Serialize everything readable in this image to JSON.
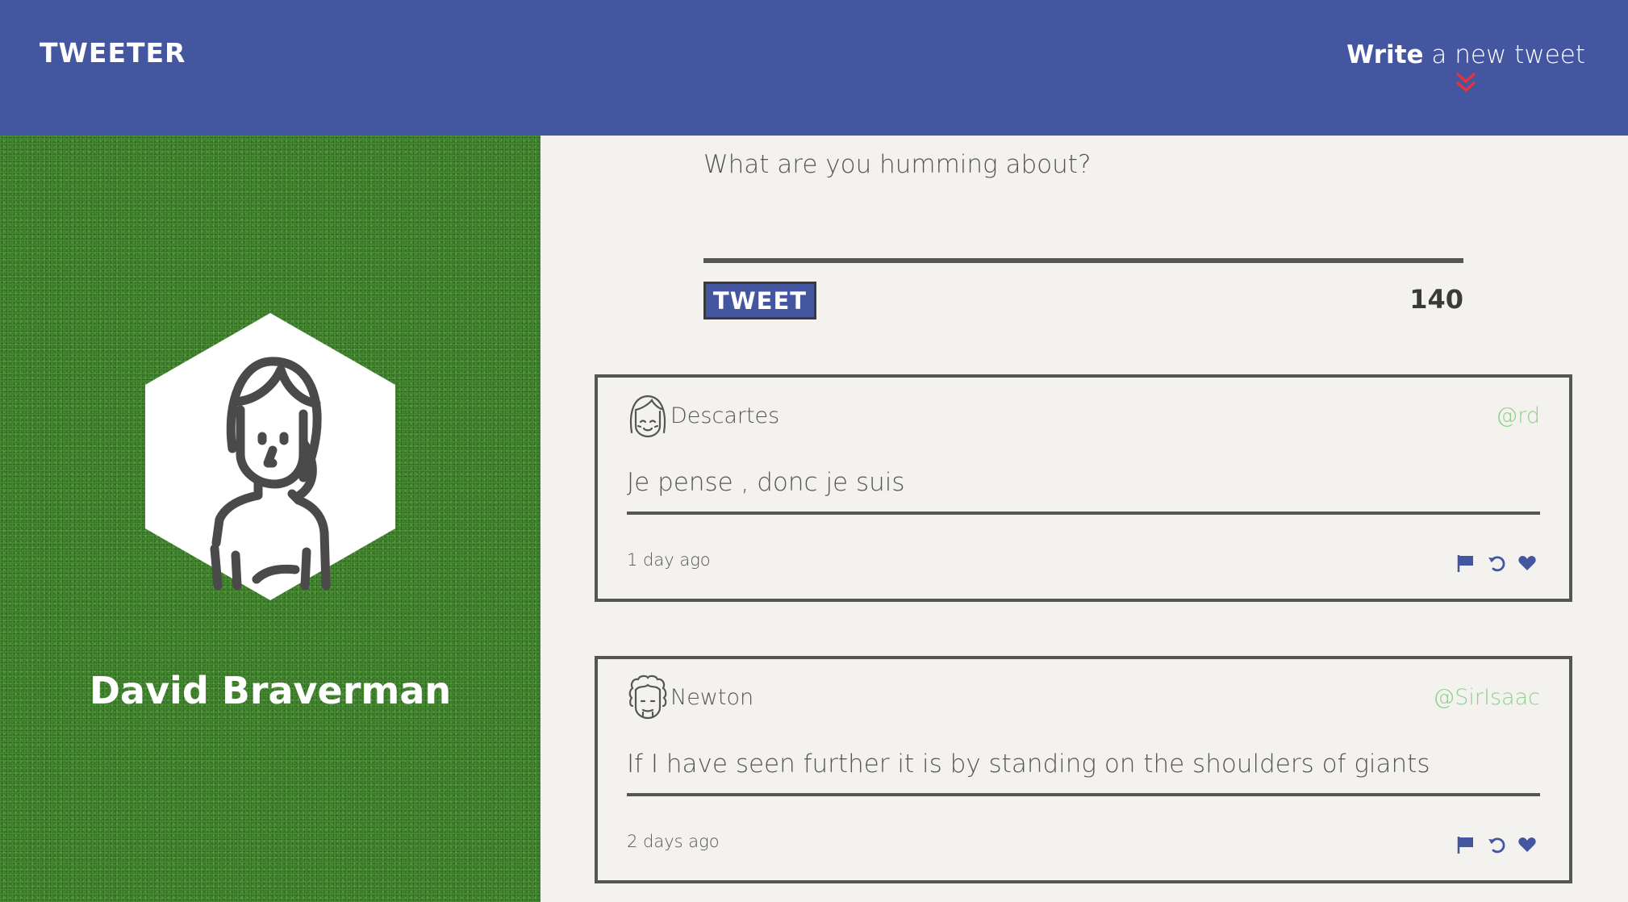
{
  "nav": {
    "brand": "TWEETER",
    "compose_bold": "Write",
    "compose_rest": " a new tweet",
    "accent_color": "#e0353b",
    "background_color": "#4556a0"
  },
  "sidebar": {
    "profile_name": "David Braverman",
    "avatar_icon": "woman-avatar-icon",
    "background_color": "#4b9236"
  },
  "compose": {
    "placeholder": "What are you humming about?",
    "button_label": "TWEET",
    "counter": "140"
  },
  "tweets": [
    {
      "author": "Descartes",
      "handle": "@rd",
      "avatar_icon": "girl-avatar-icon",
      "body": "Je pense , donc je suis",
      "time": "1 day ago",
      "actions": [
        "flag-icon",
        "retweet-icon",
        "heart-icon"
      ]
    },
    {
      "author": "Newton",
      "handle": "@SirIsaac",
      "avatar_icon": "curly-hair-avatar-icon",
      "body": "If I have seen further it is by standing on the shoulders of giants",
      "time": "2 days ago",
      "actions": [
        "flag-icon",
        "retweet-icon",
        "heart-icon"
      ]
    }
  ]
}
